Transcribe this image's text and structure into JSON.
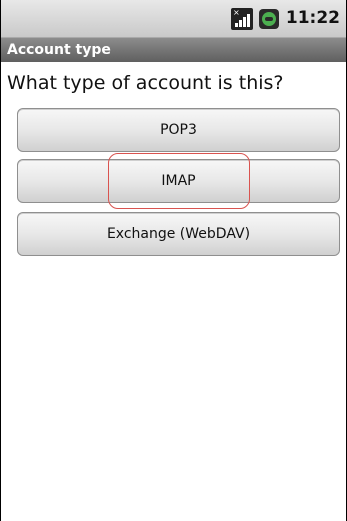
{
  "status_bar": {
    "time": "11:22",
    "icons": [
      "signal-icon",
      "battery-icon"
    ]
  },
  "title_bar": {
    "title": "Account type"
  },
  "main": {
    "prompt": "What type of account is this?",
    "options": [
      {
        "label": "POP3"
      },
      {
        "label": "IMAP"
      },
      {
        "label": "Exchange (WebDAV)"
      }
    ]
  },
  "highlight": {
    "color": "#d9534f",
    "target": "IMAP"
  }
}
